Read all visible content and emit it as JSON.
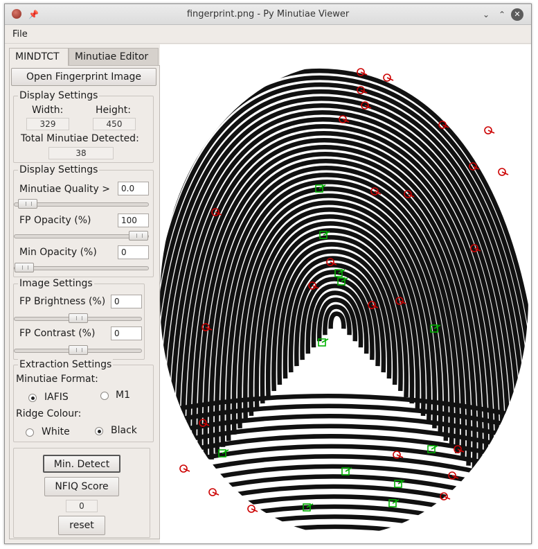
{
  "window": {
    "title": "fingerprint.png - Py Minutiae Viewer"
  },
  "menu": {
    "file": "File"
  },
  "tabs": [
    {
      "label": "MINDTCT"
    },
    {
      "label": "Minutiae Editor"
    }
  ],
  "open_button": "Open Fingerprint Image",
  "display_info": {
    "title": "Display Settings",
    "width_label": "Width:",
    "width_value": "329",
    "height_label": "Height:",
    "height_value": "450",
    "total_label": "Total Minutiae Detected:",
    "total_value": "38"
  },
  "display_settings": {
    "title": "Display Settings",
    "quality_label": "Minutiae Quality >",
    "quality_value": "0.0",
    "quality_slider_pct": 3,
    "fp_opacity_label": "FP Opacity (%)",
    "fp_opacity_value": "100",
    "fp_opacity_slider_pct": 100,
    "min_opacity_label": "Min Opacity (%)",
    "min_opacity_value": "0",
    "min_opacity_slider_pct": 0
  },
  "image_settings": {
    "title": "Image Settings",
    "brightness_label": "FP Brightness (%)",
    "brightness_value": "0",
    "brightness_slider_pct": 50,
    "contrast_label": "FP Contrast (%)",
    "contrast_value": "0",
    "contrast_slider_pct": 50
  },
  "extraction": {
    "title": "Extraction Settings",
    "format_label": "Minutiae Format:",
    "format_options": [
      "IAFIS",
      "M1"
    ],
    "format_selected": "IAFIS",
    "ridge_label": "Ridge Colour:",
    "ridge_options": [
      "White",
      "Black"
    ],
    "ridge_selected": "Black"
  },
  "actions": {
    "detect_label": "Min. Detect",
    "nfiq_label": "NFIQ Score",
    "nfiq_value": "0",
    "reset_label": "reset"
  },
  "colors": {
    "ending_marker": "#cc0000",
    "bifurcation_marker": "#00b000",
    "ridge": "#111111"
  },
  "icons": {
    "app": "app-icon",
    "pin": "pin-icon",
    "minimize": "minimize-icon",
    "maximize": "maximize-icon",
    "close": "close-icon"
  }
}
